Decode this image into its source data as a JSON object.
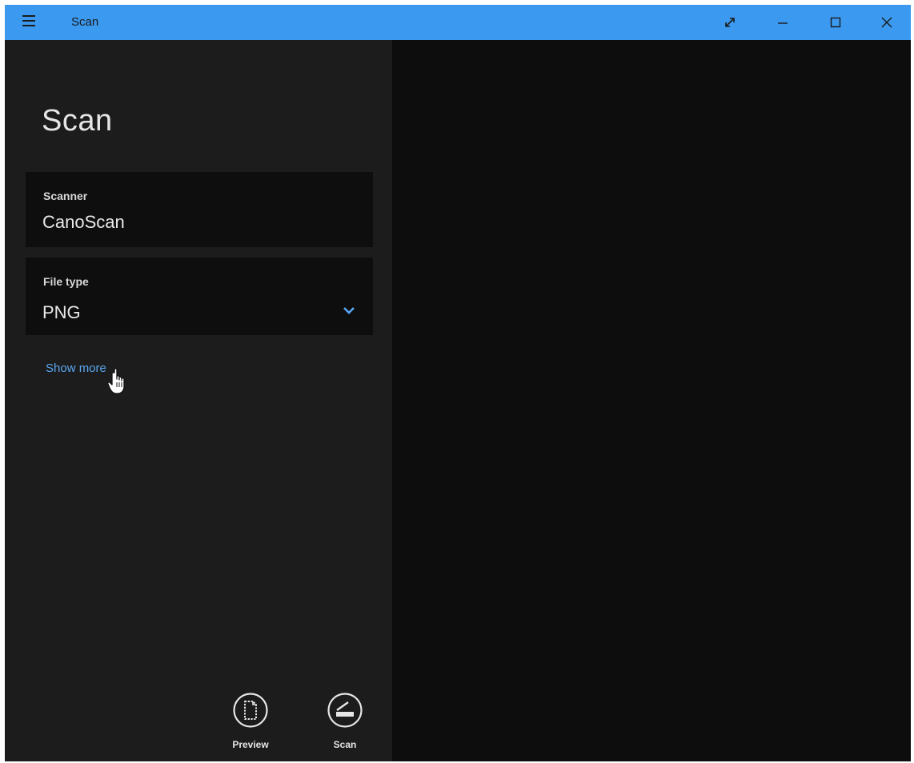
{
  "window": {
    "title": "Scan",
    "accent_color": "#3b9af0"
  },
  "titlebar": {
    "menu_icon": "hamburger-icon",
    "controls": [
      "expand-icon",
      "minimize-icon",
      "maximize-icon",
      "close-icon"
    ]
  },
  "main": {
    "heading": "Scan",
    "scanner": {
      "label": "Scanner",
      "value": "CanoScan"
    },
    "file_type": {
      "label": "File type",
      "value": "PNG",
      "icon": "chevron-down-icon"
    },
    "show_more_label": "Show more"
  },
  "commands": {
    "preview_label": "Preview",
    "preview_icon": "document-preview-icon",
    "scan_label": "Scan",
    "scan_icon": "scanner-icon"
  },
  "colors": {
    "link": "#5aa6f0",
    "pane_bg": "#1c1c1c",
    "field_bg": "#0e0e0e",
    "preview_bg": "#0d0d0d"
  }
}
